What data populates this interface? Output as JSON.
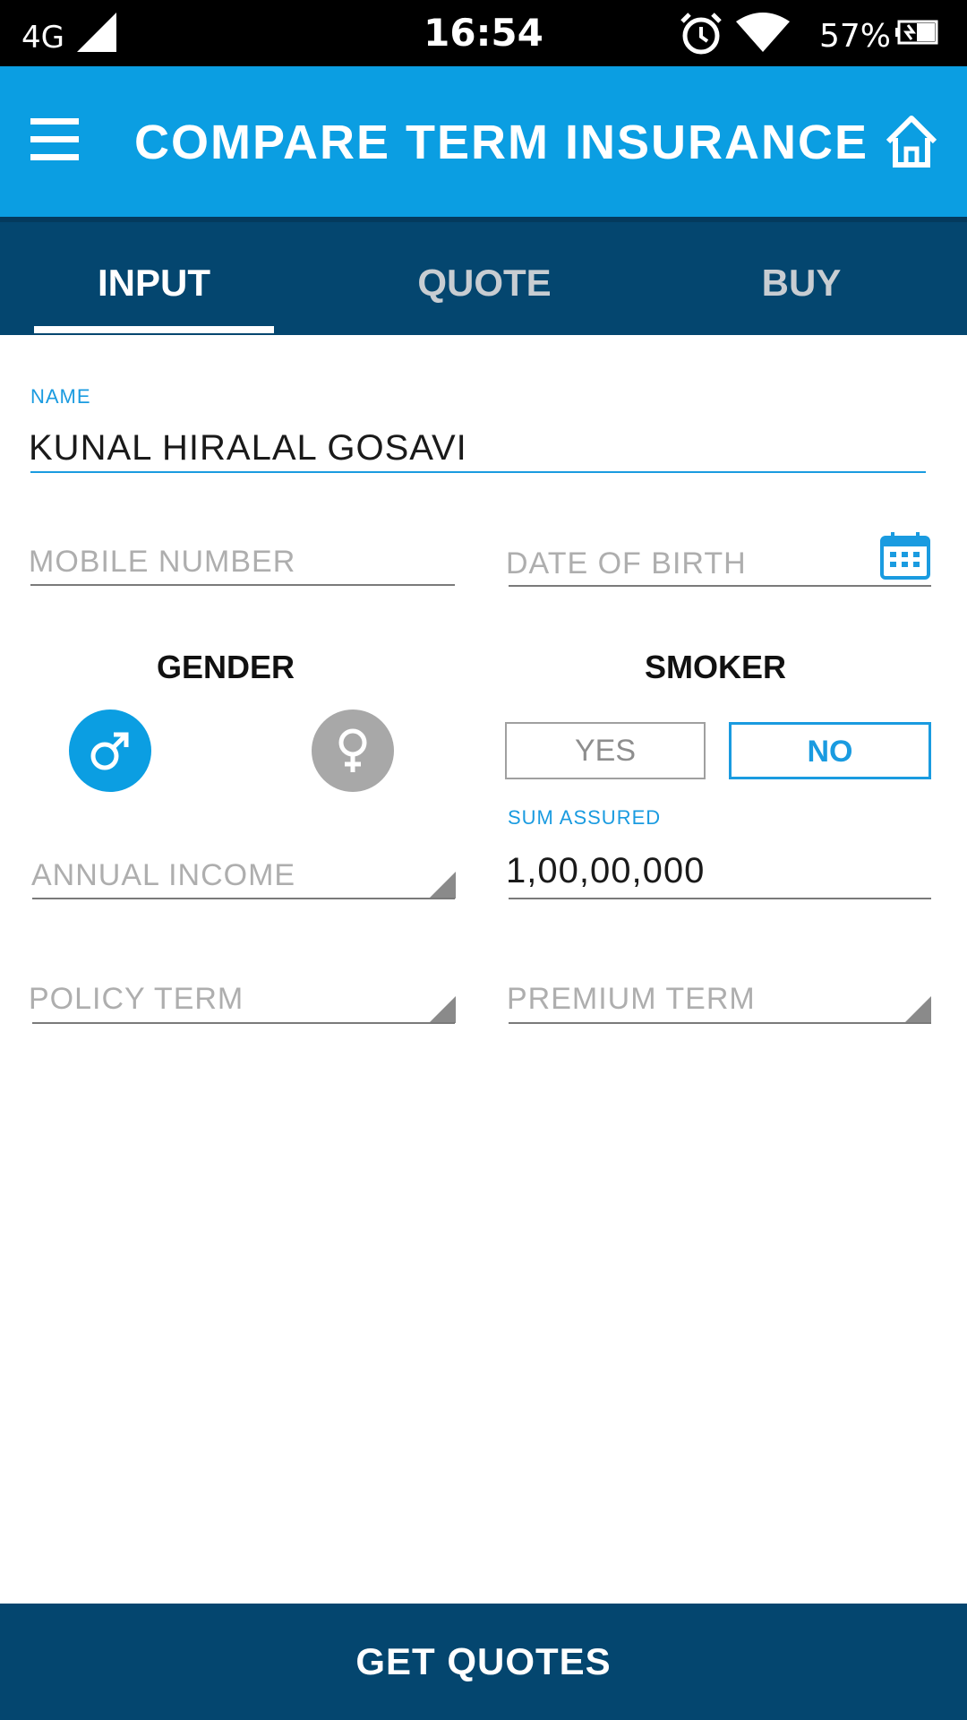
{
  "status_bar": {
    "network": "4G",
    "time": "16:54",
    "battery": "57%"
  },
  "app_bar": {
    "title": "COMPARE TERM INSURANCE",
    "menu_icon": "hamburger-menu-icon",
    "home_icon": "home-icon",
    "color": "#0b9ee2"
  },
  "tabs": [
    {
      "label": "INPUT",
      "active": true
    },
    {
      "label": "QUOTE",
      "active": false
    },
    {
      "label": "BUY",
      "active": false
    }
  ],
  "form": {
    "name": {
      "label": "NAME",
      "value": "KUNAL HIRALAL GOSAVI"
    },
    "mobile": {
      "placeholder": "MOBILE NUMBER"
    },
    "dob": {
      "placeholder": "DATE OF BIRTH"
    },
    "gender": {
      "title": "GENDER",
      "selected": "male"
    },
    "smoker": {
      "title": "SMOKER",
      "yes_label": "YES",
      "no_label": "NO",
      "selected": "NO"
    },
    "annual_income": {
      "placeholder": "ANNUAL INCOME"
    },
    "sum_assured": {
      "label": "SUM ASSURED",
      "value": "1,00,00,000"
    },
    "policy_term": {
      "placeholder": "POLICY TERM"
    },
    "premium_term": {
      "placeholder": "PREMIUM TERM"
    }
  },
  "actions": {
    "get_quotes": "GET QUOTES"
  },
  "colors": {
    "accent": "#0b9ee2",
    "dark": "#04466f"
  }
}
